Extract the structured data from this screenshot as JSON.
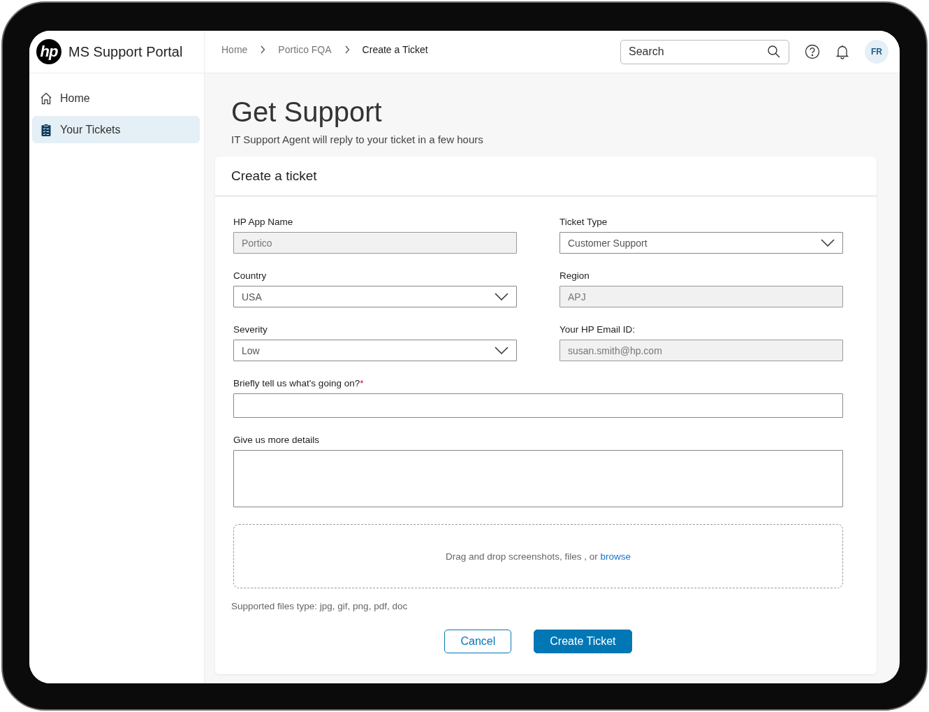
{
  "app": {
    "logo": "hp",
    "title": "MS Support Portal"
  },
  "sidebar": {
    "items": [
      {
        "label": "Home",
        "selected": false
      },
      {
        "label": "Your Tickets",
        "selected": true
      }
    ]
  },
  "breadcrumbs": [
    {
      "label": "Home",
      "current": false
    },
    {
      "label": "Portico FQA",
      "current": false
    },
    {
      "label": "Create a Ticket",
      "current": true
    }
  ],
  "search": {
    "placeholder": "Search"
  },
  "user": {
    "initials": "FR"
  },
  "page": {
    "title": "Get Support",
    "subtitle": "IT Support Agent will reply to your ticket in a few hours"
  },
  "form": {
    "title": "Create a ticket",
    "rows": [
      [
        {
          "label": "HP App Name",
          "kind": "text",
          "value": "Portico",
          "readonly": true
        },
        {
          "label": "Ticket Type",
          "kind": "select",
          "value": "Customer Support",
          "readonly": false
        }
      ],
      [
        {
          "label": "Country",
          "kind": "select",
          "value": "USA",
          "readonly": false
        },
        {
          "label": "Region",
          "kind": "text",
          "value": "APJ",
          "readonly": true
        }
      ],
      [
        {
          "label": "Severity",
          "kind": "select",
          "value": "Low",
          "readonly": false
        },
        {
          "label": "Your HP Email ID:",
          "kind": "text",
          "value": "susan.smith@hp.com",
          "readonly": true
        }
      ],
      [
        {
          "label": "Briefly tell us what's going on?",
          "required_mark": "*",
          "kind": "text",
          "readonly": false
        }
      ],
      [
        {
          "label": "Give us more details",
          "kind": "textarea",
          "readonly": false
        }
      ]
    ],
    "upload": {
      "text": "Drag and drop screenshots, files , or",
      "link": "browse"
    },
    "note": "Supported files type: jpg, gif, png, pdf, doc",
    "buttons": [
      {
        "label": "Cancel",
        "kind": "secondary"
      },
      {
        "label": "Create Ticket",
        "kind": "primary"
      }
    ]
  }
}
